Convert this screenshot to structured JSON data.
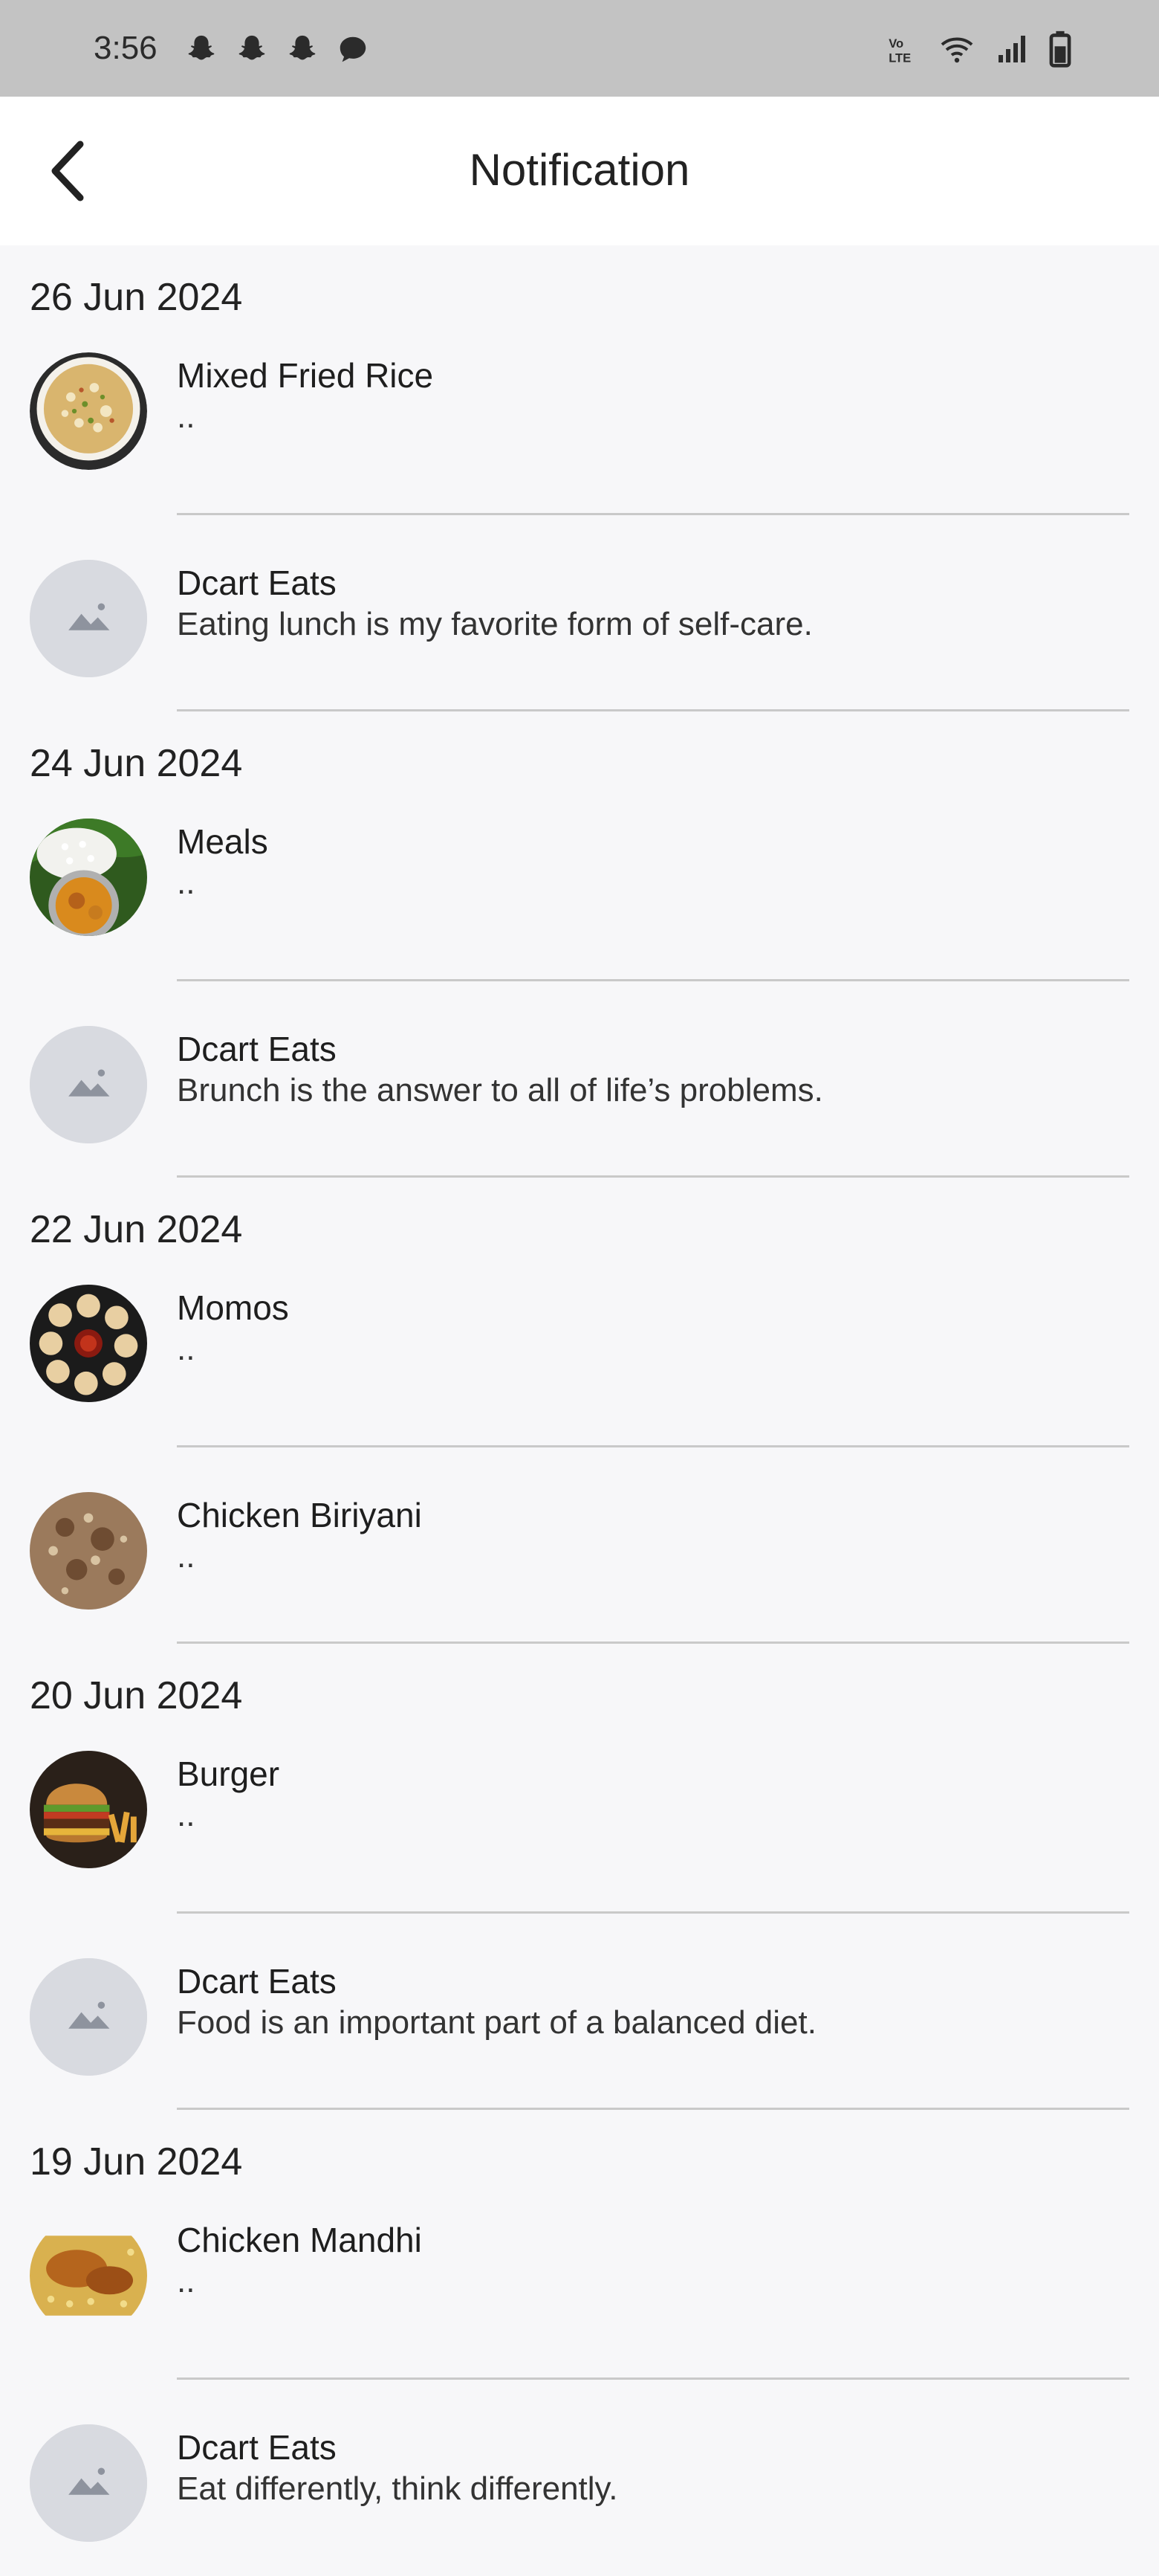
{
  "status_bar": {
    "time": "3:56",
    "notification_icons": [
      "snapchat-icon",
      "snapchat-icon",
      "snapchat-icon",
      "message-icon"
    ],
    "right_icons": [
      "volte-icon",
      "wifi-icon",
      "signal-icon",
      "battery-icon"
    ]
  },
  "header": {
    "title": "Notification",
    "back_icon": "chevron-left-icon"
  },
  "groups": [
    {
      "date": "26 Jun 2024",
      "items": [
        {
          "title": "Mixed Fried Rice",
          "subtitle": "..",
          "image": "fried-rice"
        },
        {
          "title": "Dcart Eats",
          "subtitle": "Eating lunch is my favorite form of self-care.",
          "image": "placeholder"
        }
      ]
    },
    {
      "date": "24 Jun 2024",
      "items": [
        {
          "title": "Meals",
          "subtitle": "..",
          "image": "meals"
        },
        {
          "title": "Dcart Eats",
          "subtitle": "Brunch is the answer to all of life’s problems.",
          "image": "placeholder"
        }
      ]
    },
    {
      "date": "22 Jun 2024",
      "items": [
        {
          "title": "Momos",
          "subtitle": "..",
          "image": "momos"
        },
        {
          "title": "Chicken Biriyani",
          "subtitle": "..",
          "image": "biriyani"
        }
      ]
    },
    {
      "date": "20 Jun 2024",
      "items": [
        {
          "title": "Burger",
          "subtitle": "..",
          "image": "burger"
        },
        {
          "title": "Dcart Eats",
          "subtitle": "Food is an important part of a balanced diet.",
          "image": "placeholder"
        }
      ]
    },
    {
      "date": "19 Jun 2024",
      "items": [
        {
          "title": "Chicken Mandhi",
          "subtitle": "..",
          "image": "mandhi"
        },
        {
          "title": "Dcart Eats",
          "subtitle": "Eat differently, think differently.",
          "image": "placeholder"
        }
      ]
    }
  ],
  "colors": {
    "status_bar_bg": "#c3c3c3",
    "page_bg": "#f7f7f9",
    "divider": "#c9c9c9",
    "placeholder_bg": "#d8dae0"
  }
}
